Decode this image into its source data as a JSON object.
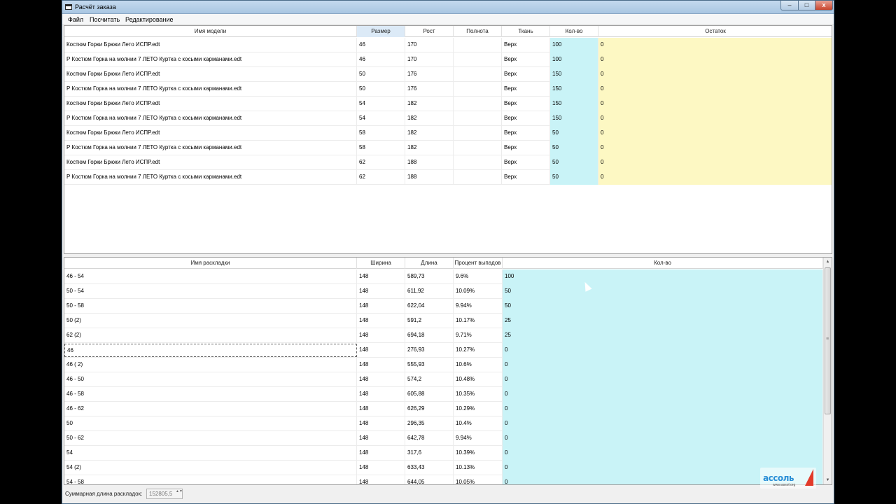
{
  "window": {
    "title": "Расчёт заказа",
    "min_icon": "minimize-icon",
    "max_icon": "maximize-icon",
    "close_icon": "close-icon",
    "min_glyph": "–",
    "max_glyph": "□",
    "close_glyph": "x"
  },
  "menu": [
    "Файл",
    "Посчитать",
    "Редактирование"
  ],
  "models_table": {
    "columns": [
      "Имя модели",
      "Размер",
      "Рост",
      "Полнота",
      "Ткань",
      "Кол-во",
      "Остаток"
    ],
    "rows": [
      [
        "Костюм Горки  Брюки Лето ИСПР.edt",
        "46",
        "170",
        "",
        "Верх",
        "100",
        "0"
      ],
      [
        "Р Костюм Горка на молнии 7 ЛЕТО Куртка с косыми карманами.edt",
        "46",
        "170",
        "",
        "Верх",
        "100",
        "0"
      ],
      [
        "Костюм Горки  Брюки Лето ИСПР.edt",
        "50",
        "176",
        "",
        "Верх",
        "150",
        "0"
      ],
      [
        "Р Костюм Горка на молнии 7 ЛЕТО Куртка с косыми карманами.edt",
        "50",
        "176",
        "",
        "Верх",
        "150",
        "0"
      ],
      [
        "Костюм Горки  Брюки Лето ИСПР.edt",
        "54",
        "182",
        "",
        "Верх",
        "150",
        "0"
      ],
      [
        "Р Костюм Горка на молнии 7 ЛЕТО Куртка с косыми карманами.edt",
        "54",
        "182",
        "",
        "Верх",
        "150",
        "0"
      ],
      [
        "Костюм Горки  Брюки Лето ИСПР.edt",
        "58",
        "182",
        "",
        "Верх",
        "50",
        "0"
      ],
      [
        "Р Костюм Горка на молнии 7 ЛЕТО Куртка с косыми карманами.edt",
        "58",
        "182",
        "",
        "Верх",
        "50",
        "0"
      ],
      [
        "Костюм Горки  Брюки Лето ИСПР.edt",
        "62",
        "188",
        "",
        "Верх",
        "50",
        "0"
      ],
      [
        "Р Костюм Горка на молнии 7 ЛЕТО Куртка с косыми карманами.edt",
        "62",
        "188",
        "",
        "Верх",
        "50",
        "0"
      ]
    ]
  },
  "layouts_table": {
    "columns": [
      "Имя раскладки",
      "Ширина",
      "Длина",
      "Процент выпадов",
      "Кол-во"
    ],
    "rows": [
      [
        "46 - 54",
        "148",
        "589,73",
        "9.6%",
        "100"
      ],
      [
        "50 - 54",
        "148",
        "611,92",
        "10.09%",
        "50"
      ],
      [
        "50 - 58",
        "148",
        "622,04",
        "9.94%",
        "50"
      ],
      [
        "50 (2)",
        "148",
        "591,2",
        "10.17%",
        "25"
      ],
      [
        "62 (2)",
        "148",
        "694,18",
        "9.71%",
        "25"
      ],
      [
        "46",
        "148",
        "276,93",
        "10.27%",
        "0"
      ],
      [
        "46 ( 2)",
        "148",
        "555,93",
        "10.6%",
        "0"
      ],
      [
        "46 - 50",
        "148",
        "574,2",
        "10.48%",
        "0"
      ],
      [
        "46 - 58",
        "148",
        "605,88",
        "10.35%",
        "0"
      ],
      [
        "46 - 62",
        "148",
        "626,29",
        "10.29%",
        "0"
      ],
      [
        "50",
        "148",
        "296,35",
        "10.4%",
        "0"
      ],
      [
        "50 - 62",
        "148",
        "642,78",
        "9.94%",
        "0"
      ],
      [
        "54",
        "148",
        "317,6",
        "10.39%",
        "0"
      ],
      [
        "54 (2)",
        "148",
        "633,43",
        "10.13%",
        "0"
      ],
      [
        "54 - 58",
        "148",
        "644,05",
        "10.05%",
        "0"
      ]
    ],
    "scroll_up_glyph": "▲",
    "scroll_down_glyph": "▼",
    "scroll_grip_glyph": "≡"
  },
  "status": {
    "label": "Суммарная длина раскладок:",
    "value": "152805,5",
    "spin_glyph": "▲▼"
  },
  "watermark": {
    "name": "ассоль",
    "url": "www.assol.org"
  },
  "colors": {
    "qty_cyan": "#c9f3f7",
    "remain_yellow": "#fdf8c3",
    "sorted_header": "#dceaf7"
  }
}
